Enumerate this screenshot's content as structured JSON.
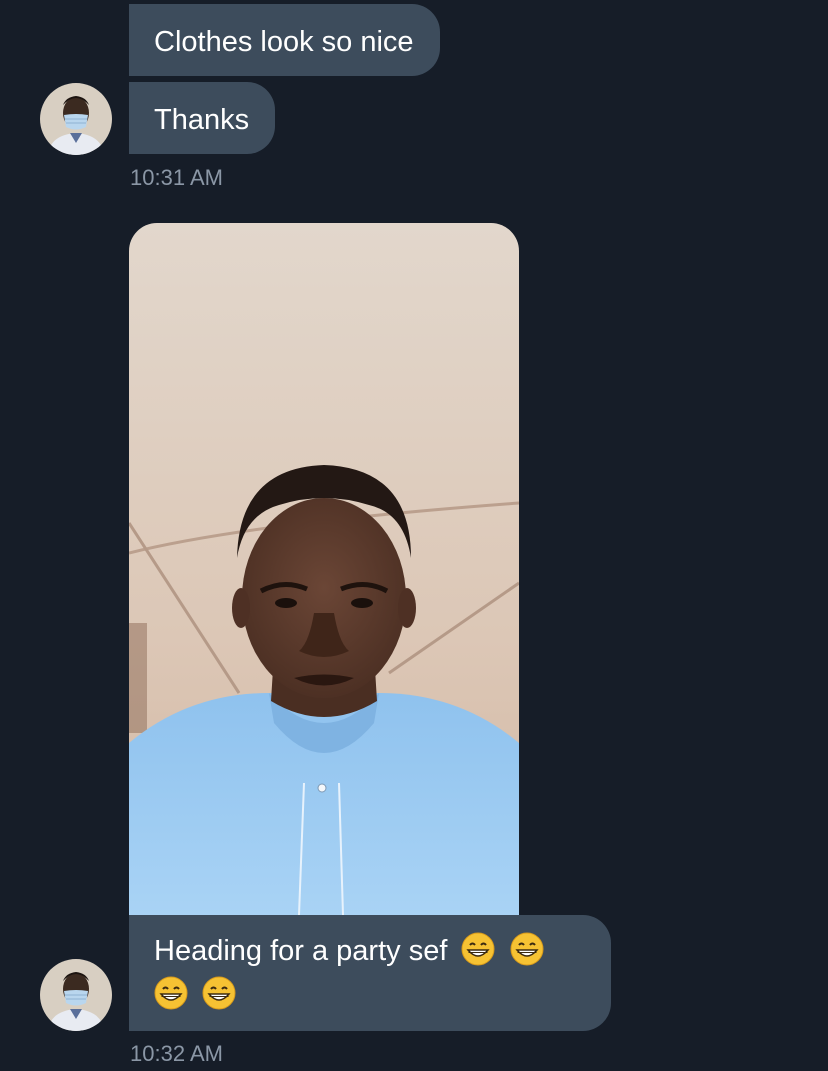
{
  "messages": [
    {
      "text": "Clothes look so nice"
    },
    {
      "text": "Thanks"
    },
    {
      "timestamp": "10:31 AM"
    },
    {
      "caption": "Heading for a party sef",
      "emoji": [
        "grinning-face",
        "grinning-face",
        "grinning-face",
        "grinning-face"
      ]
    },
    {
      "timestamp": "10:32 AM"
    }
  ],
  "colors": {
    "background": "#161d28",
    "bubble": "#3d4c5c",
    "text": "#ffffff",
    "timestamp": "#8b97a6"
  }
}
